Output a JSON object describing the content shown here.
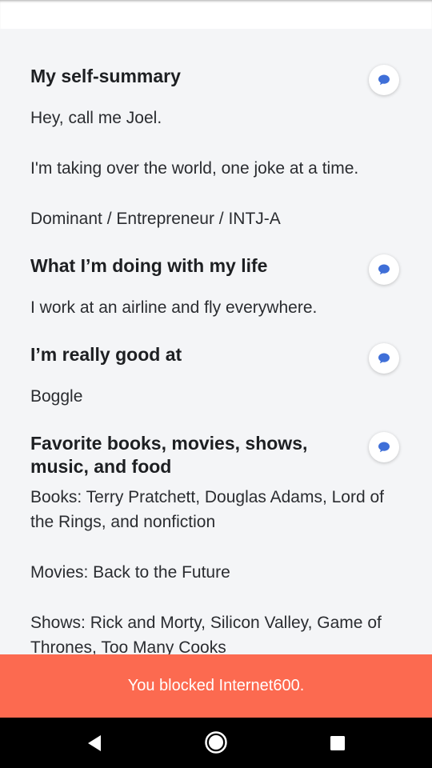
{
  "profile": {
    "sections": [
      {
        "heading": "My self-summary",
        "paragraphs": [
          "Hey, call me Joel.",
          "I'm taking over the world, one joke at a time.",
          "Dominant / Entrepreneur / INTJ-A"
        ]
      },
      {
        "heading": "What I’m doing with my life",
        "paragraphs": [
          "I work at an airline and fly everywhere."
        ]
      },
      {
        "heading": "I’m really good at",
        "paragraphs": [
          "Boggle"
        ]
      },
      {
        "heading": "Favorite books, movies, shows, music, and food",
        "paragraphs": [
          "Books: Terry Pratchett, Douglas Adams, Lord of the Rings, and nonfiction",
          "Movies: Back to the Future",
          "Shows: Rick and Morty, Silicon Valley, Game of Thrones, Too Many Cooks"
        ]
      }
    ],
    "message_icon": "chat-bubble-icon"
  },
  "toast": {
    "text": "You blocked Internet600."
  },
  "navbar": {
    "back_icon": "back-triangle-icon",
    "home_icon": "home-circle-icon",
    "recents_icon": "recents-square-icon"
  },
  "colors": {
    "toast_bg": "#fc6a50",
    "accent_blue": "#3f6fd8",
    "page_bg": "#f4f5f7"
  }
}
